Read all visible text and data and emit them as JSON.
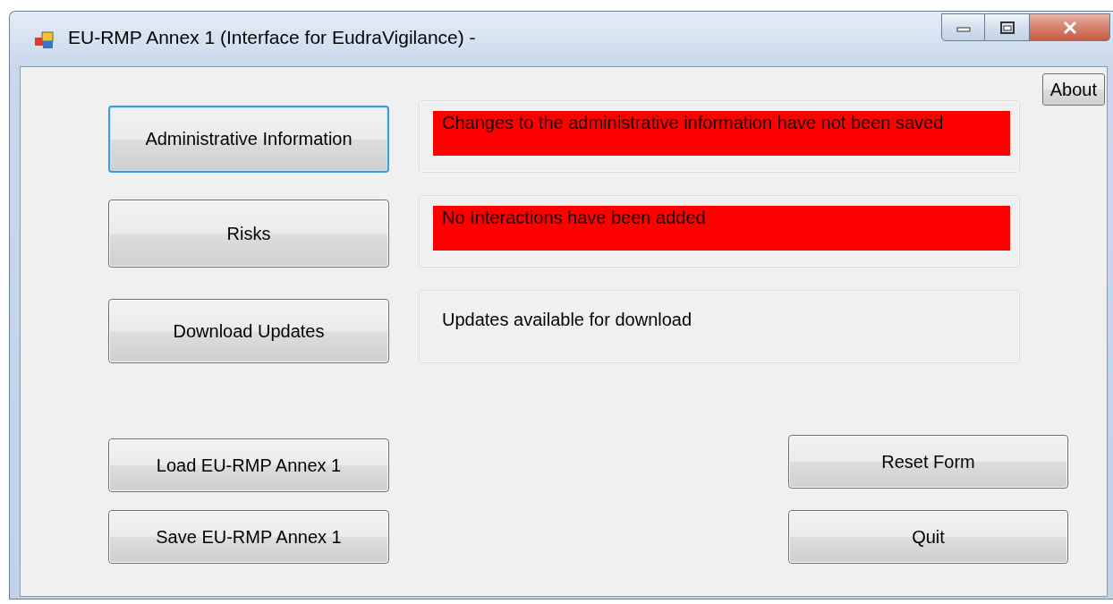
{
  "window": {
    "title": "EU-RMP Annex 1 (Interface for EudraVigilance) -"
  },
  "about_button": "About",
  "sections": [
    {
      "button": {
        "label": "Administrative Information",
        "focused": true
      },
      "status": {
        "text": "Changes to the administrative information have not been saved",
        "alert": true
      }
    },
    {
      "button": {
        "label": "Risks",
        "focused": false
      },
      "status": {
        "text": "No Interactions have been added",
        "alert": true
      }
    },
    {
      "button": {
        "label": "Download Updates",
        "focused": false
      },
      "status": {
        "text": "Updates available for download",
        "alert": false
      }
    }
  ],
  "file_buttons": [
    "Load EU-RMP Annex 1",
    "Save EU-RMP Annex 1"
  ],
  "form_buttons": [
    "Reset Form",
    "Quit"
  ]
}
